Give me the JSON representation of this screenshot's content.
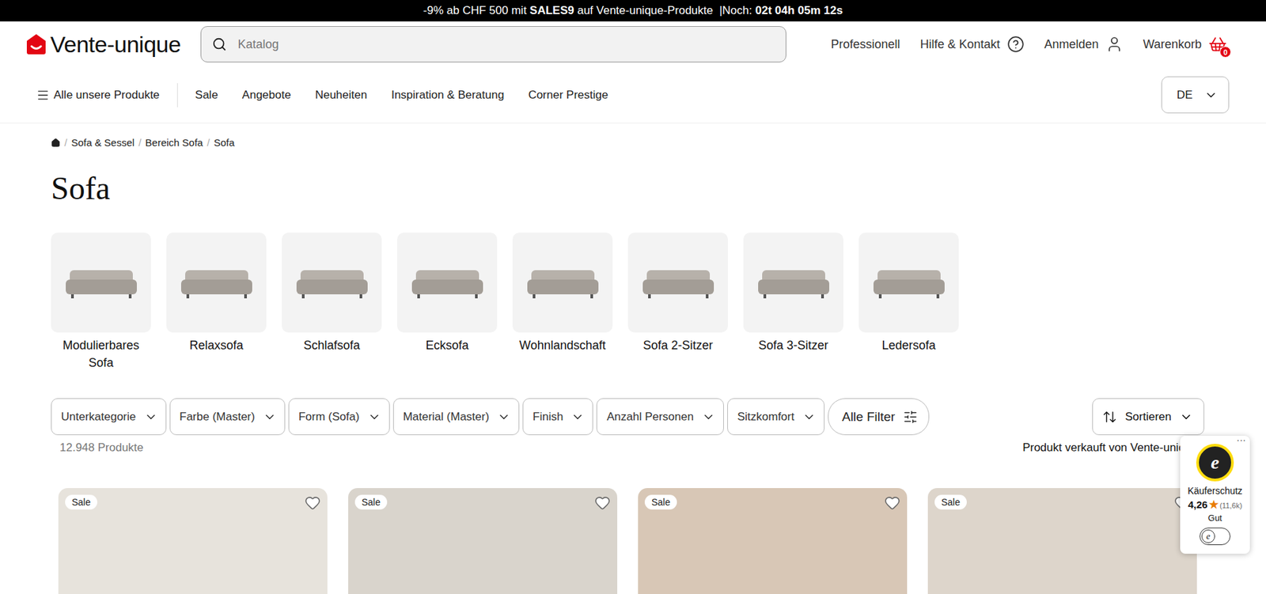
{
  "banner": {
    "parts": [
      {
        "text": "-9% ab CHF 500 mit ",
        "bold": false
      },
      {
        "text": "SALES9",
        "bold": true
      },
      {
        "text": " auf Vente-unique-Produkte ",
        "bold": false
      },
      {
        "text": " |Noch: ",
        "bold": false
      },
      {
        "text": "02t 04h 05m 12s",
        "bold": true
      }
    ]
  },
  "logo": {
    "text": "Vente-unique"
  },
  "search": {
    "placeholder": "Katalog"
  },
  "header_links": [
    {
      "label": "Professionell",
      "kind": "text"
    },
    {
      "label": "Hilfe & Kontakt",
      "kind": "help"
    },
    {
      "label": "Anmelden",
      "kind": "user"
    },
    {
      "label": "Warenkorb",
      "kind": "cart",
      "badge": "0"
    }
  ],
  "nav": {
    "menu": "Alle unsere Produkte",
    "items": [
      "Sale",
      "Angebote",
      "Neuheiten",
      "Inspiration & Beratung",
      "Corner Prestige"
    ]
  },
  "language": {
    "value": "DE"
  },
  "breadcrumb": [
    "Sofa & Sessel",
    "Bereich Sofa",
    "Sofa"
  ],
  "title": "Sofa",
  "categories": [
    "Modulierbares Sofa",
    "Relaxsofa",
    "Schlafsofa",
    "Ecksofa",
    "Wohnlandschaft",
    "Sofa 2-Sitzer",
    "Sofa 3-Sitzer",
    "Ledersofa"
  ],
  "filters": [
    "Unterkategorie",
    "Farbe (Master)",
    "Form (Sofa)",
    "Material (Master)",
    "Finish",
    "Anzahl Personen",
    "Sitzkomfort"
  ],
  "all_filters": "Alle Filter",
  "sort": "Sortieren",
  "count": "12.948 Produkte",
  "seller": "Produkt verkauft von Vente-unique",
  "products": [
    {
      "badge": "Sale",
      "favorite": false
    },
    {
      "badge": "Sale",
      "favorite": false
    },
    {
      "badge": "Sale",
      "favorite": false
    },
    {
      "badge": "Sale",
      "favorite": false
    }
  ],
  "trust_badge": {
    "menu": "···",
    "seal": "e",
    "title": "Käuferschutz",
    "rating": "4,26",
    "star": "★",
    "reviews": "(11,6k)",
    "grade": "Gut"
  }
}
